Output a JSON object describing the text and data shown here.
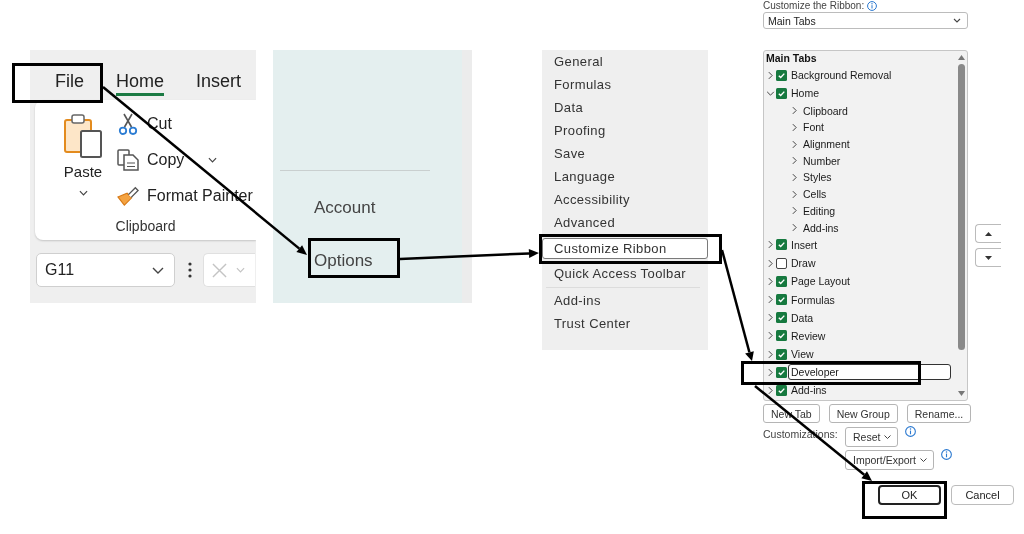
{
  "ribbon": {
    "tabs": [
      {
        "label": "File",
        "selected": false
      },
      {
        "label": "Home",
        "selected": true
      },
      {
        "label": "Insert",
        "selected": false
      }
    ],
    "clipboard": {
      "paste": {
        "label": "Paste"
      },
      "commands": [
        {
          "kind": "cut",
          "label": "Cut",
          "dropdown": false
        },
        {
          "kind": "copy",
          "label": "Copy",
          "dropdown": true
        },
        {
          "kind": "format_painter",
          "label": "Format Painter",
          "dropdown": false
        }
      ],
      "title": "Clipboard"
    },
    "name_box": {
      "value": "G11"
    }
  },
  "backstage": {
    "items": [
      {
        "label": "Account"
      },
      {
        "label": "Options"
      }
    ]
  },
  "options_nav": {
    "groups": [
      {
        "items": [
          {
            "label": "General",
            "selected": false
          },
          {
            "label": "Formulas",
            "selected": false
          },
          {
            "label": "Data",
            "selected": false
          },
          {
            "label": "Proofing",
            "selected": false
          },
          {
            "label": "Save",
            "selected": false
          },
          {
            "label": "Language",
            "selected": false
          },
          {
            "label": "Accessibility",
            "selected": false
          },
          {
            "label": "Advanced",
            "selected": false
          },
          {
            "label": "Customize Ribbon",
            "selected": true
          },
          {
            "label": "Quick Access Toolbar",
            "selected": false
          }
        ]
      },
      {
        "items": [
          {
            "label": "Add-ins",
            "selected": false
          },
          {
            "label": "Trust Center",
            "selected": false
          }
        ]
      }
    ]
  },
  "customize_ribbon": {
    "label": "Customize the Ribbon:",
    "dropdown": {
      "value": "Main Tabs"
    },
    "tree": {
      "header": "Main Tabs",
      "items": [
        {
          "label": "Background Removal",
          "expanded": false,
          "checked": true,
          "selected": false
        },
        {
          "label": "Home",
          "expanded": true,
          "checked": true,
          "selected": false,
          "children": [
            {
              "label": "Clipboard",
              "expanded": false,
              "selected": false
            },
            {
              "label": "Font",
              "expanded": false,
              "selected": false
            },
            {
              "label": "Alignment",
              "expanded": false,
              "selected": false
            },
            {
              "label": "Number",
              "expanded": false,
              "selected": false
            },
            {
              "label": "Styles",
              "expanded": false,
              "selected": false
            },
            {
              "label": "Cells",
              "expanded": false,
              "selected": false
            },
            {
              "label": "Editing",
              "expanded": false,
              "selected": false
            },
            {
              "label": "Add-ins",
              "expanded": false,
              "selected": false
            }
          ]
        },
        {
          "label": "Insert",
          "expanded": false,
          "checked": true,
          "selected": false
        },
        {
          "label": "Draw",
          "expanded": false,
          "checked": false,
          "selected": false
        },
        {
          "label": "Page Layout",
          "expanded": false,
          "checked": true,
          "selected": false
        },
        {
          "label": "Formulas",
          "expanded": false,
          "checked": true,
          "selected": false
        },
        {
          "label": "Data",
          "expanded": false,
          "checked": true,
          "selected": false
        },
        {
          "label": "Review",
          "expanded": false,
          "checked": true,
          "selected": false
        },
        {
          "label": "View",
          "expanded": false,
          "checked": true,
          "selected": false
        },
        {
          "label": "Developer",
          "expanded": false,
          "checked": true,
          "selected": true
        },
        {
          "label": "Add-ins",
          "expanded": false,
          "checked": true,
          "selected": false
        }
      ]
    },
    "tab_buttons": [
      {
        "label": "New Tab"
      },
      {
        "label": "New Group"
      },
      {
        "label": "Rename..."
      }
    ],
    "customizations": {
      "label": "Customizations:",
      "buttons": [
        {
          "label": "Reset"
        },
        {
          "label": "Import/Export"
        }
      ]
    }
  },
  "dialog_buttons": [
    {
      "label": "OK",
      "default": true
    },
    {
      "label": "Cancel",
      "default": false
    }
  ]
}
